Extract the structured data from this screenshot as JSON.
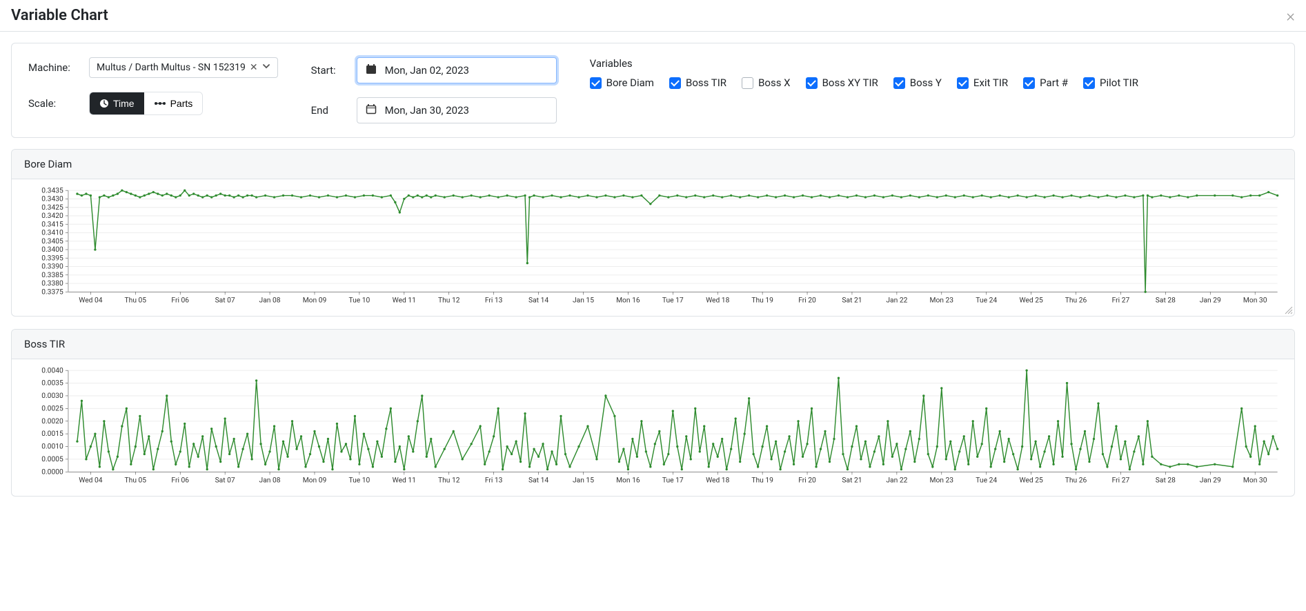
{
  "modal": {
    "title": "Variable Chart"
  },
  "controls": {
    "machine_label": "Machine:",
    "machine_value": "Multus / Darth Multus - SN 152319",
    "scale_label": "Scale:",
    "scale_options": {
      "time": "Time",
      "parts": "Parts"
    },
    "start_label": "Start:",
    "start_value": "Mon, Jan 02, 2023",
    "end_label": "End",
    "end_value": "Mon, Jan 30, 2023",
    "variables_label": "Variables",
    "variables": [
      {
        "id": "bore_diam",
        "label": "Bore Diam",
        "checked": true
      },
      {
        "id": "boss_tir",
        "label": "Boss TIR",
        "checked": true
      },
      {
        "id": "boss_x",
        "label": "Boss X",
        "checked": false
      },
      {
        "id": "boss_xy_tir",
        "label": "Boss XY TIR",
        "checked": true
      },
      {
        "id": "boss_y",
        "label": "Boss Y",
        "checked": true
      },
      {
        "id": "exit_tir",
        "label": "Exit TIR",
        "checked": true
      },
      {
        "id": "part_no",
        "label": "Part #",
        "checked": true
      },
      {
        "id": "pilot_tir",
        "label": "Pilot TIR",
        "checked": true
      }
    ]
  },
  "chart_data": [
    {
      "id": "bore_diam_chart",
      "type": "line",
      "title": "Bore Diam",
      "xlabel": "",
      "ylabel": "",
      "ylim": [
        0.3375,
        0.3435
      ],
      "yticks": [
        0.3375,
        0.338,
        0.3385,
        0.339,
        0.3395,
        0.34,
        0.3405,
        0.341,
        0.3415,
        0.342,
        0.3425,
        0.343,
        0.3435
      ],
      "x_categories": [
        "Wed 04",
        "Thu 05",
        "Fri 06",
        "Sat 07",
        "Jan 08",
        "Mon 09",
        "Tue 10",
        "Wed 11",
        "Thu 12",
        "Fri 13",
        "Sat 14",
        "Jan 15",
        "Mon 16",
        "Tue 17",
        "Wed 18",
        "Thu 19",
        "Fri 20",
        "Sat 21",
        "Jan 22",
        "Mon 23",
        "Tue 24",
        "Wed 25",
        "Thu 26",
        "Fri 27",
        "Sat 28",
        "Jan 29",
        "Mon 30"
      ],
      "series": [
        {
          "name": "Bore Diam",
          "x_index": [
            0,
            0.1,
            0.2,
            0.3,
            0.4,
            0.5,
            0.6,
            0.7,
            0.8,
            0.9,
            1,
            1.1,
            1.2,
            1.3,
            1.4,
            1.5,
            1.6,
            1.7,
            1.8,
            1.9,
            2,
            2.1,
            2.2,
            2.3,
            2.4,
            2.5,
            2.6,
            2.7,
            2.8,
            2.9,
            3,
            3.1,
            3.2,
            3.3,
            3.4,
            3.5,
            3.6,
            3.7,
            3.8,
            3.9,
            4,
            4.2,
            4.4,
            4.6,
            4.8,
            5,
            5.2,
            5.4,
            5.6,
            5.8,
            6,
            6.2,
            6.4,
            6.6,
            6.8,
            7,
            7.1,
            7.2,
            7.3,
            7.4,
            7.5,
            7.6,
            7.7,
            7.8,
            7.9,
            8,
            8.2,
            8.4,
            8.6,
            8.8,
            9,
            9.2,
            9.4,
            9.6,
            9.8,
            10,
            10.05,
            10.1,
            10.2,
            10.4,
            10.6,
            10.8,
            11,
            11.2,
            11.4,
            11.6,
            11.8,
            12,
            12.2,
            12.4,
            12.6,
            12.8,
            13,
            13.2,
            13.4,
            13.6,
            13.8,
            14,
            14.2,
            14.4,
            14.6,
            14.8,
            15,
            15.2,
            15.4,
            15.6,
            15.8,
            16,
            16.2,
            16.4,
            16.6,
            16.8,
            17,
            17.2,
            17.4,
            17.6,
            17.8,
            18,
            18.2,
            18.4,
            18.6,
            18.8,
            19,
            19.2,
            19.4,
            19.6,
            19.8,
            20,
            20.2,
            20.4,
            20.6,
            20.8,
            21,
            21.2,
            21.4,
            21.6,
            21.8,
            22,
            22.2,
            22.4,
            22.6,
            22.8,
            23,
            23.2,
            23.4,
            23.6,
            23.8,
            23.85,
            23.9,
            24,
            24.2,
            24.4,
            24.6,
            24.8,
            25,
            25.4,
            25.8,
            26,
            26.2,
            26.4,
            26.6,
            26.8
          ],
          "values": [
            0.3433,
            0.3432,
            0.3433,
            0.3432,
            0.34,
            0.3431,
            0.3432,
            0.3431,
            0.3432,
            0.3433,
            0.3435,
            0.3434,
            0.3433,
            0.3432,
            0.3431,
            0.3432,
            0.3433,
            0.3434,
            0.3433,
            0.3432,
            0.3433,
            0.3432,
            0.3431,
            0.3432,
            0.3435,
            0.3432,
            0.3433,
            0.3432,
            0.3431,
            0.3432,
            0.3431,
            0.3432,
            0.3433,
            0.3432,
            0.3432,
            0.3431,
            0.3432,
            0.3431,
            0.3432,
            0.3432,
            0.3431,
            0.3432,
            0.3431,
            0.3432,
            0.3432,
            0.3431,
            0.3432,
            0.3431,
            0.3432,
            0.3431,
            0.3432,
            0.3431,
            0.3432,
            0.3432,
            0.3431,
            0.3432,
            0.3428,
            0.3422,
            0.343,
            0.3432,
            0.3431,
            0.3432,
            0.3431,
            0.3432,
            0.3431,
            0.3432,
            0.3431,
            0.3432,
            0.3431,
            0.3432,
            0.3431,
            0.3432,
            0.3431,
            0.3432,
            0.3431,
            0.3432,
            0.3392,
            0.3431,
            0.3432,
            0.3431,
            0.3432,
            0.3431,
            0.3432,
            0.3431,
            0.3432,
            0.3431,
            0.3432,
            0.3431,
            0.3432,
            0.3431,
            0.3432,
            0.3427,
            0.3432,
            0.3431,
            0.3432,
            0.3431,
            0.3432,
            0.3431,
            0.3432,
            0.3431,
            0.3432,
            0.3431,
            0.3432,
            0.3431,
            0.3432,
            0.3431,
            0.3432,
            0.3431,
            0.3432,
            0.3431,
            0.3432,
            0.3431,
            0.3432,
            0.3431,
            0.3432,
            0.3431,
            0.3432,
            0.3431,
            0.3432,
            0.3431,
            0.3432,
            0.3431,
            0.3432,
            0.3431,
            0.3432,
            0.3431,
            0.3432,
            0.3431,
            0.3432,
            0.3431,
            0.3432,
            0.3431,
            0.3432,
            0.3431,
            0.3432,
            0.3431,
            0.3432,
            0.3431,
            0.3432,
            0.3431,
            0.3432,
            0.3431,
            0.3432,
            0.3431,
            0.3432,
            0.3431,
            0.3432,
            0.3375,
            0.3432,
            0.3431,
            0.3432,
            0.3431,
            0.3432,
            0.3431,
            0.3432,
            0.3432,
            0.3432,
            0.3431,
            0.3432,
            0.3432,
            0.3434,
            0.3432
          ]
        }
      ]
    },
    {
      "id": "boss_tir_chart",
      "type": "line",
      "title": "Boss TIR",
      "xlabel": "",
      "ylabel": "",
      "ylim": [
        0.0,
        0.004
      ],
      "yticks": [
        0.0,
        0.0005,
        0.001,
        0.0015,
        0.002,
        0.0025,
        0.003,
        0.0035,
        0.004
      ],
      "x_categories": [
        "Wed 04",
        "Thu 05",
        "Fri 06",
        "Sat 07",
        "Jan 08",
        "Mon 09",
        "Tue 10",
        "Wed 11",
        "Thu 12",
        "Fri 13",
        "Sat 14",
        "Jan 15",
        "Mon 16",
        "Tue 17",
        "Wed 18",
        "Thu 19",
        "Fri 20",
        "Sat 21",
        "Jan 22",
        "Mon 23",
        "Tue 24",
        "Wed 25",
        "Thu 26",
        "Fri 27",
        "Sat 28",
        "Jan 29",
        "Mon 30"
      ],
      "series": [
        {
          "name": "Boss TIR",
          "x_index": [
            0,
            0.1,
            0.2,
            0.3,
            0.4,
            0.5,
            0.6,
            0.7,
            0.8,
            0.9,
            1,
            1.1,
            1.2,
            1.3,
            1.4,
            1.5,
            1.6,
            1.7,
            1.8,
            1.9,
            2,
            2.1,
            2.2,
            2.3,
            2.4,
            2.5,
            2.6,
            2.7,
            2.8,
            2.9,
            3,
            3.1,
            3.2,
            3.3,
            3.4,
            3.5,
            3.6,
            3.7,
            3.8,
            3.9,
            4,
            4.1,
            4.2,
            4.3,
            4.4,
            4.5,
            4.6,
            4.7,
            4.8,
            4.9,
            5,
            5.1,
            5.2,
            5.3,
            5.4,
            5.5,
            5.6,
            5.7,
            5.8,
            5.9,
            6,
            6.1,
            6.2,
            6.3,
            6.4,
            6.5,
            6.6,
            6.7,
            6.8,
            6.9,
            7,
            7.1,
            7.2,
            7.3,
            7.4,
            7.5,
            7.6,
            7.7,
            7.8,
            7.9,
            8,
            8.2,
            8.4,
            8.6,
            8.8,
            9,
            9.1,
            9.2,
            9.3,
            9.4,
            9.5,
            9.6,
            9.7,
            9.8,
            9.9,
            10,
            10.1,
            10.2,
            10.3,
            10.4,
            10.5,
            10.6,
            10.7,
            10.8,
            10.9,
            11,
            11.2,
            11.4,
            11.6,
            11.8,
            12,
            12.1,
            12.2,
            12.3,
            12.4,
            12.5,
            12.6,
            12.7,
            12.8,
            12.9,
            13,
            13.1,
            13.2,
            13.3,
            13.4,
            13.5,
            13.6,
            13.7,
            13.8,
            13.9,
            14,
            14.1,
            14.2,
            14.3,
            14.4,
            14.5,
            14.6,
            14.7,
            14.8,
            14.9,
            15,
            15.1,
            15.2,
            15.3,
            15.4,
            15.5,
            15.6,
            15.7,
            15.8,
            15.9,
            16,
            16.1,
            16.2,
            16.3,
            16.4,
            16.5,
            16.6,
            16.7,
            16.8,
            16.9,
            17,
            17.1,
            17.2,
            17.3,
            17.4,
            17.5,
            17.6,
            17.7,
            17.8,
            17.9,
            18,
            18.1,
            18.2,
            18.3,
            18.4,
            18.5,
            18.6,
            18.7,
            18.8,
            18.9,
            19,
            19.1,
            19.2,
            19.3,
            19.4,
            19.5,
            19.6,
            19.7,
            19.8,
            19.9,
            20,
            20.1,
            20.2,
            20.3,
            20.4,
            20.5,
            20.6,
            20.7,
            20.8,
            20.9,
            21,
            21.1,
            21.2,
            21.3,
            21.4,
            21.5,
            21.6,
            21.7,
            21.8,
            21.9,
            22,
            22.1,
            22.2,
            22.3,
            22.4,
            22.5,
            22.6,
            22.7,
            22.8,
            22.9,
            23,
            23.1,
            23.2,
            23.3,
            23.4,
            23.5,
            23.6,
            23.7,
            23.8,
            23.9,
            24,
            24.2,
            24.4,
            24.6,
            24.8,
            25,
            25.4,
            25.8,
            26,
            26.1,
            26.2,
            26.3,
            26.4,
            26.5,
            26.6,
            26.7,
            26.8
          ],
          "values": [
            0.0012,
            0.0028,
            0.0005,
            0.001,
            0.0015,
            0.0002,
            0.002,
            0.0008,
            0.0001,
            0.0006,
            0.0018,
            0.0025,
            0.0003,
            0.001,
            0.0022,
            0.0007,
            0.0014,
            0.0001,
            0.0009,
            0.0016,
            0.003,
            0.0012,
            0.0003,
            0.0008,
            0.0019,
            0.0002,
            0.0011,
            0.0006,
            0.0014,
            0.0001,
            0.0017,
            0.001,
            0.0004,
            0.0021,
            0.0007,
            0.0013,
            0.0002,
            0.0009,
            0.0015,
            0.0005,
            0.0036,
            0.0011,
            0.0003,
            0.0008,
            0.0018,
            0.0001,
            0.0012,
            0.0006,
            0.002,
            0.0009,
            0.0014,
            0.0002,
            0.0007,
            0.0016,
            0.001,
            0.0004,
            0.0013,
            0.0001,
            0.0019,
            0.0008,
            0.0011,
            0.0005,
            0.0022,
            0.0003,
            0.0015,
            0.0009,
            0.0002,
            0.0012,
            0.0006,
            0.0017,
            0.0025,
            0.0004,
            0.001,
            0.0001,
            0.0014,
            0.0008,
            0.002,
            0.003,
            0.0006,
            0.0013,
            0.0002,
            0.0009,
            0.0016,
            0.0005,
            0.0011,
            0.0018,
            0.0003,
            0.0008,
            0.0014,
            0.0025,
            0.0001,
            0.001,
            0.0007,
            0.0012,
            0.0004,
            0.0023,
            0.0002,
            0.0009,
            0.0006,
            0.0011,
            0.0001,
            0.0008,
            0.0003,
            0.0022,
            0.0007,
            0.0002,
            0.001,
            0.0018,
            0.0005,
            0.003,
            0.0022,
            0.0004,
            0.0009,
            0.0001,
            0.0013,
            0.0006,
            0.002,
            0.0008,
            0.0002,
            0.0011,
            0.0016,
            0.0003,
            0.0007,
            0.0024,
            0.001,
            0.0001,
            0.0014,
            0.0005,
            0.0025,
            0.0008,
            0.0018,
            0.0002,
            0.0011,
            0.0006,
            0.0013,
            0.0001,
            0.0009,
            0.0021,
            0.0004,
            0.0015,
            0.0029,
            0.0007,
            0.0002,
            0.001,
            0.0018,
            0.0005,
            0.0012,
            0.0001,
            0.0008,
            0.0014,
            0.0003,
            0.002,
            0.0006,
            0.0011,
            0.0025,
            0.0002,
            0.0009,
            0.0016,
            0.0004,
            0.0013,
            0.0037,
            0.0007,
            0.0001,
            0.001,
            0.0018,
            0.0005,
            0.0012,
            0.0002,
            0.0008,
            0.0014,
            0.0003,
            0.002,
            0.0006,
            0.0011,
            0.0001,
            0.0009,
            0.0016,
            0.0004,
            0.0013,
            0.003,
            0.0007,
            0.0002,
            0.001,
            0.0033,
            0.0005,
            0.0012,
            0.0001,
            0.0008,
            0.0014,
            0.0003,
            0.002,
            0.0006,
            0.0011,
            0.0025,
            0.0002,
            0.0009,
            0.0016,
            0.0004,
            0.0013,
            0.0007,
            0.0001,
            0.001,
            0.004,
            0.0005,
            0.0012,
            0.0002,
            0.0008,
            0.0014,
            0.0003,
            0.002,
            0.0006,
            0.0035,
            0.0011,
            0.0001,
            0.0009,
            0.0016,
            0.0004,
            0.0013,
            0.0027,
            0.0007,
            0.0002,
            0.001,
            0.0018,
            0.0005,
            0.0012,
            0.0001,
            0.0008,
            0.0014,
            0.0003,
            0.002,
            0.0006,
            0.0003,
            0.0002,
            0.0003,
            0.0003,
            0.0002,
            0.0003,
            0.0002,
            0.0025,
            0.001,
            0.0006,
            0.0018,
            0.0003,
            0.0012,
            0.0007,
            0.0014,
            0.0009
          ]
        }
      ]
    }
  ]
}
